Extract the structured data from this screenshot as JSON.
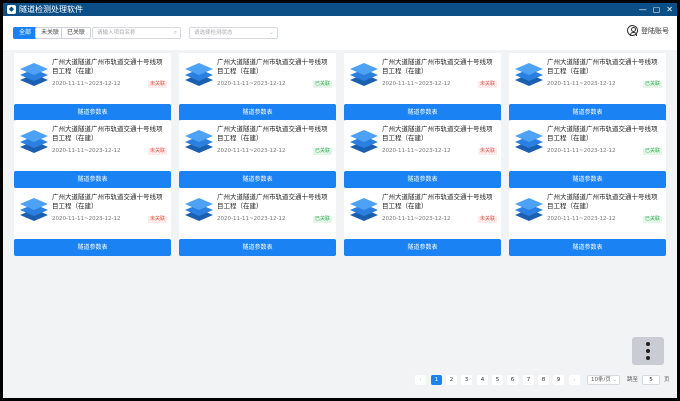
{
  "window": {
    "title": "隧道检测处理软件",
    "controls": [
      "—",
      "▢",
      "✕"
    ]
  },
  "toolbar": {
    "filters": [
      "全部",
      "未关联",
      "已关联"
    ],
    "active_filter": "全部",
    "search": {
      "placeholder": "请输入项目名称"
    },
    "status_select": {
      "placeholder": "请选择检测状态"
    },
    "login_label": "登陆账号"
  },
  "cards": [
    {
      "title": "广州大道隧道广州市轨道交通十号线项目工程（在建）",
      "dates": "2020-11-11~2023-12-12",
      "status": "未关联",
      "action": "隧道参数表"
    },
    {
      "title": "广州大道隧道广州市轨道交通十号线项目工程（在建）",
      "dates": "2020-11-11~2023-12-12",
      "status": "已关联",
      "action": "隧道参数表"
    },
    {
      "title": "广州大道隧道广州市轨道交通十号线项目工程（在建）",
      "dates": "2020-11-11~2023-12-12",
      "status": "未关联",
      "action": "隧道参数表"
    },
    {
      "title": "广州大道隧道广州市轨道交通十号线项目工程（在建）",
      "dates": "2020-11-11~2023-12-12",
      "status": "已关联",
      "action": "隧道参数表"
    },
    {
      "title": "广州大道隧道广州市轨道交通十号线项目工程（在建）",
      "dates": "2020-11-11~2023-12-12",
      "status": "未关联",
      "action": "隧道参数表"
    },
    {
      "title": "广州大道隧道广州市轨道交通十号线项目工程（在建）",
      "dates": "2020-11-11~2023-12-12",
      "status": "已关联",
      "action": "隧道参数表"
    },
    {
      "title": "广州大道隧道广州市轨道交通十号线项目工程（在建）",
      "dates": "2020-11-11~2023-12-12",
      "status": "未关联",
      "action": "隧道参数表"
    },
    {
      "title": "广州大道隧道广州市轨道交通十号线项目工程（在建）",
      "dates": "2020-11-11~2023-12-12",
      "status": "已关联",
      "action": "隧道参数表"
    },
    {
      "title": "广州大道隧道广州市轨道交通十号线项目工程（在建）",
      "dates": "2020-11-11~2023-12-12",
      "status": "未关联",
      "action": "隧道参数表"
    },
    {
      "title": "广州大道隧道广州市轨道交通十号线项目工程（在建）",
      "dates": "2020-11-11~2023-12-12",
      "status": "已关联",
      "action": "隧道参数表"
    },
    {
      "title": "广州大道隧道广州市轨道交通十号线项目工程（在建）",
      "dates": "2020-11-11~2023-12-12",
      "status": "未关联",
      "action": "隧道参数表"
    },
    {
      "title": "广州大道隧道广州市轨道交通十号线项目工程（在建）",
      "dates": "2020-11-11~2023-12-12",
      "status": "已关联",
      "action": "隧道参数表"
    }
  ],
  "pagination": {
    "prev": "‹",
    "next": "›",
    "pages": [
      "1",
      "2",
      "3",
      "4",
      "5",
      "6",
      "7",
      "8",
      "9"
    ],
    "current": "1",
    "page_size": "10条/页",
    "goto_prefix": "跳至",
    "goto_value": "5",
    "goto_suffix": "页"
  },
  "colors": {
    "primary": "#1a82f3",
    "titlebar": "#0c4f86",
    "unlinked": "#e0584f",
    "linked": "#36b15a"
  },
  "icons": {
    "card": "stack-layers-icon",
    "more": "more-vertical-icon",
    "login": "user-circle-icon"
  }
}
